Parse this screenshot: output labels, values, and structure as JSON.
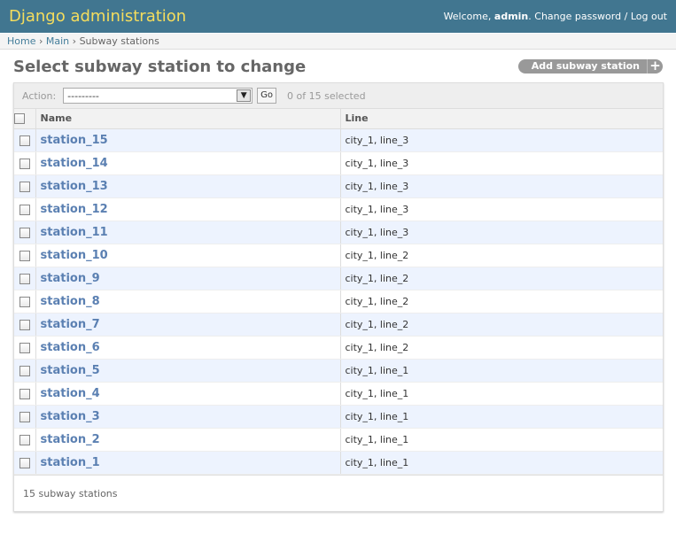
{
  "header": {
    "branding": "Django administration",
    "welcome": "Welcome,",
    "username": "admin",
    "change_password": "Change password",
    "separator": "/",
    "logout": "Log out"
  },
  "breadcrumbs": {
    "home": "Home",
    "app": "Main",
    "current": "Subway stations",
    "sep": "›"
  },
  "page": {
    "title": "Select subway station to change",
    "add_button": "Add subway station",
    "add_icon": "+"
  },
  "actions": {
    "label": "Action:",
    "selected_value": "---------",
    "go_label": "Go",
    "counter": "0 of 15 selected",
    "dropdown_icon": "chevron-down-icon"
  },
  "table": {
    "columns": [
      "Name",
      "Line"
    ],
    "rows": [
      {
        "name": "station_15",
        "line": "city_1, line_3"
      },
      {
        "name": "station_14",
        "line": "city_1, line_3"
      },
      {
        "name": "station_13",
        "line": "city_1, line_3"
      },
      {
        "name": "station_12",
        "line": "city_1, line_3"
      },
      {
        "name": "station_11",
        "line": "city_1, line_3"
      },
      {
        "name": "station_10",
        "line": "city_1, line_2"
      },
      {
        "name": "station_9",
        "line": "city_1, line_2"
      },
      {
        "name": "station_8",
        "line": "city_1, line_2"
      },
      {
        "name": "station_7",
        "line": "city_1, line_2"
      },
      {
        "name": "station_6",
        "line": "city_1, line_2"
      },
      {
        "name": "station_5",
        "line": "city_1, line_1"
      },
      {
        "name": "station_4",
        "line": "city_1, line_1"
      },
      {
        "name": "station_3",
        "line": "city_1, line_1"
      },
      {
        "name": "station_2",
        "line": "city_1, line_1"
      },
      {
        "name": "station_1",
        "line": "city_1, line_1"
      }
    ]
  },
  "paginator": {
    "text": "15 subway stations"
  },
  "colors": {
    "header_bg": "#417690",
    "branding": "#f5dd5d",
    "link": "#5b80b2",
    "row_alt": "#edf3fe"
  }
}
